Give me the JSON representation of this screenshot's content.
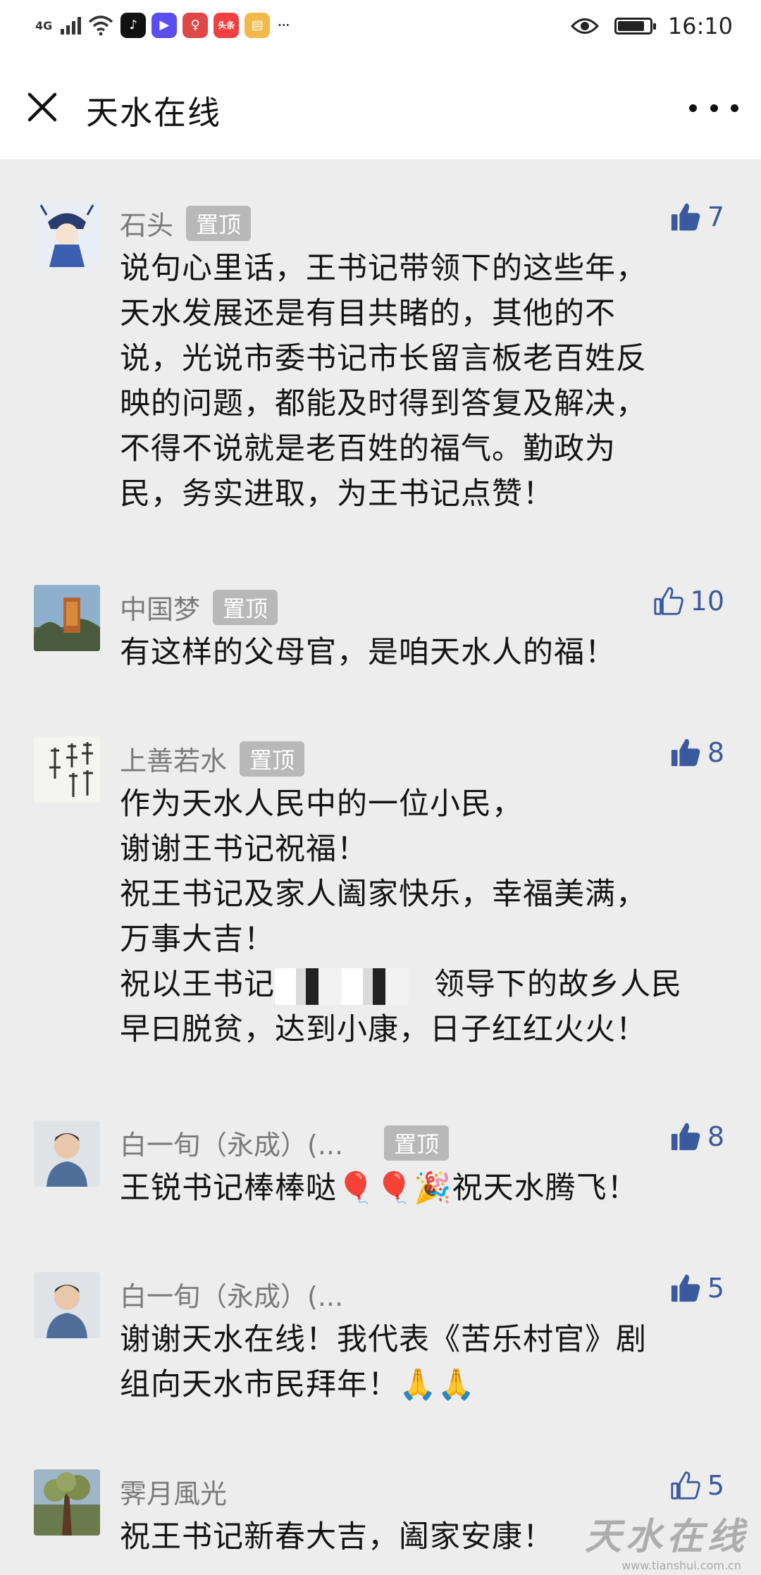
{
  "status_bar": {
    "network": "4G",
    "time": "16:10",
    "battery_level": 0.85,
    "app_icons": [
      {
        "name": "tiktok-icon",
        "glyph": "♪",
        "color": "#111111"
      },
      {
        "name": "video-app-icon",
        "glyph": "▶",
        "color": "#5b4df0"
      },
      {
        "name": "map-pin-app-icon",
        "glyph": "♀",
        "color": "#e04848"
      },
      {
        "name": "toutiao-icon",
        "glyph": "头条",
        "color": "#f04142"
      },
      {
        "name": "notes-app-icon",
        "glyph": "▤",
        "color": "#f0b94a"
      }
    ]
  },
  "header": {
    "title": "天水在线"
  },
  "accent_color": "#3a5aa0",
  "comments": [
    {
      "nickname": "石头",
      "pinned": true,
      "pin_label": "置顶",
      "likes": "7",
      "liked": true,
      "lines": [
        "说句心里话，王书记带领下的这些年，",
        "天水发展还是有目共睹的，其他的不",
        "说，光说市委书记市长留言板老百姓反",
        "映的问题，都能及时得到答复及解决，",
        "不得不说就是老百姓的福气。勤政为",
        "民，务实进取，为王书记点赞！"
      ]
    },
    {
      "nickname": "中国梦",
      "pinned": true,
      "pin_label": "置顶",
      "likes": "10",
      "liked": false,
      "lines": [
        "有这样的父母官，是咱天水人的福！"
      ]
    },
    {
      "nickname": "上善若水",
      "pinned": true,
      "pin_label": "置顶",
      "likes": "8",
      "liked": true,
      "lines": [
        "作为天水人民中的一位小民，",
        "谢谢王书记祝福！",
        "祝王书记及家人阖家快乐，幸福美满，",
        "万事大吉！",
        "祝以王书记",
        "早曰脱贫，达到小康，日子红红火火！"
      ],
      "line5_suffix": "领导下的故乡人民"
    },
    {
      "nickname": "白一旬（永成）(...",
      "pinned": true,
      "pin_label": "置顶",
      "likes": "8",
      "liked": true,
      "lines": [
        "王锐书记棒棒哒🎈🎈🎉祝天水腾飞！"
      ]
    },
    {
      "nickname": "白一旬（永成）(...",
      "pinned": false,
      "pin_label": "",
      "likes": "5",
      "liked": true,
      "lines": [
        "谢谢天水在线！我代表《苦乐村官》剧",
        "组向天水市民拜年！🙏🙏"
      ]
    },
    {
      "nickname": "霁月風光",
      "pinned": false,
      "pin_label": "",
      "likes": "5",
      "liked": false,
      "lines": [
        "祝王书记新春大吉，阖家安康！"
      ]
    }
  ],
  "watermark": {
    "text": "天水在线",
    "url": "www.tianshui.com.cn"
  }
}
